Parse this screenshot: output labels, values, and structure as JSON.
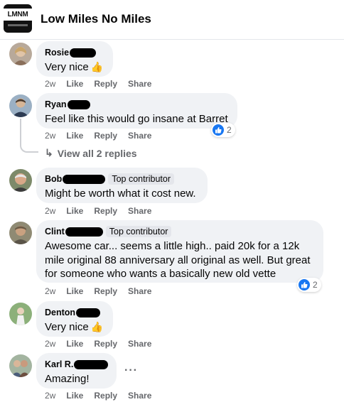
{
  "header": {
    "group_name": "Low Miles No Miles",
    "logo_text": "LMNM"
  },
  "colors": {
    "like_blue": "#1877f2",
    "bubble_bg": "#f0f2f5",
    "meta_gray": "#65676b"
  },
  "actions": {
    "like": "Like",
    "reply": "Reply",
    "share": "Share"
  },
  "comments": [
    {
      "author": "Rosie",
      "text": "Very nice",
      "emoji": "thumbs-up-emoji",
      "time": "2w"
    },
    {
      "author": "Ryan",
      "text": "Feel like this would go insane at Barret",
      "time": "2w",
      "reactions": "2",
      "view_replies": "View all 2 replies"
    },
    {
      "author": "Bob",
      "badge": "Top contributor",
      "text": "Might be worth what it cost new.",
      "time": "2w"
    },
    {
      "author": "Clint",
      "badge": "Top contributor",
      "text_lines": [
        "Awesome car... seems a little high.. paid 20k for a 12k",
        "mile original 88 anniversary all original as well. But great",
        "for someone who wants a basically new old vette"
      ],
      "time": "2w",
      "reactions": "2"
    },
    {
      "author": "Denton",
      "text": "Very nice",
      "emoji": "thumbs-up-emoji",
      "time": "2w"
    },
    {
      "author": "Karl R.",
      "text": "Amazing!",
      "time": "2w",
      "more": "···"
    }
  ]
}
